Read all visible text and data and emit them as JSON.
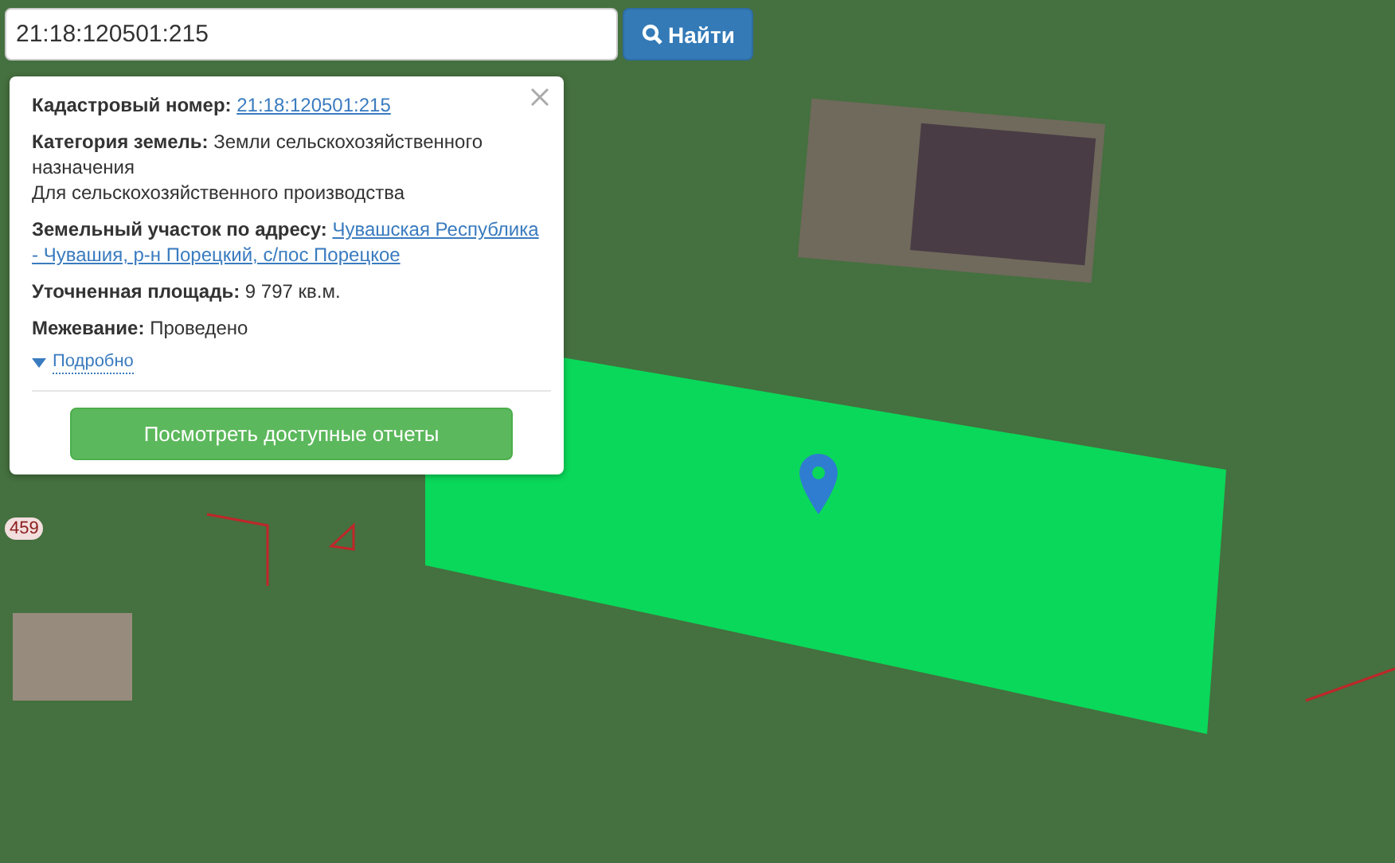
{
  "search": {
    "value": "21:18:120501:215",
    "button": "Найти"
  },
  "popup": {
    "fields": [
      {
        "kind": "link",
        "label": "Кадастровый номер:",
        "lines": [
          "21:18:120501:215"
        ]
      },
      {
        "kind": "text",
        "label": "Категория земель:",
        "lines": [
          "Земли сельскохозяйственного назначения",
          "Для сельскохозяйственного производства"
        ]
      },
      {
        "kind": "link",
        "label": "Земельный участок по адресу:",
        "lines": [
          "Чувашская Республика",
          "- Чувашия, р-н Порецкий, с/пос Порецкое"
        ]
      },
      {
        "kind": "text",
        "label": "Уточненная площадь:",
        "lines": [
          "9 797 кв.м."
        ]
      },
      {
        "kind": "text",
        "label": "Межевание:",
        "lines": [
          "Проведено"
        ]
      }
    ],
    "details": {
      "label": "Подробно",
      "expanded": false
    },
    "button": "Посмотреть доступные отчеты"
  },
  "map": {
    "road_label": "459"
  }
}
